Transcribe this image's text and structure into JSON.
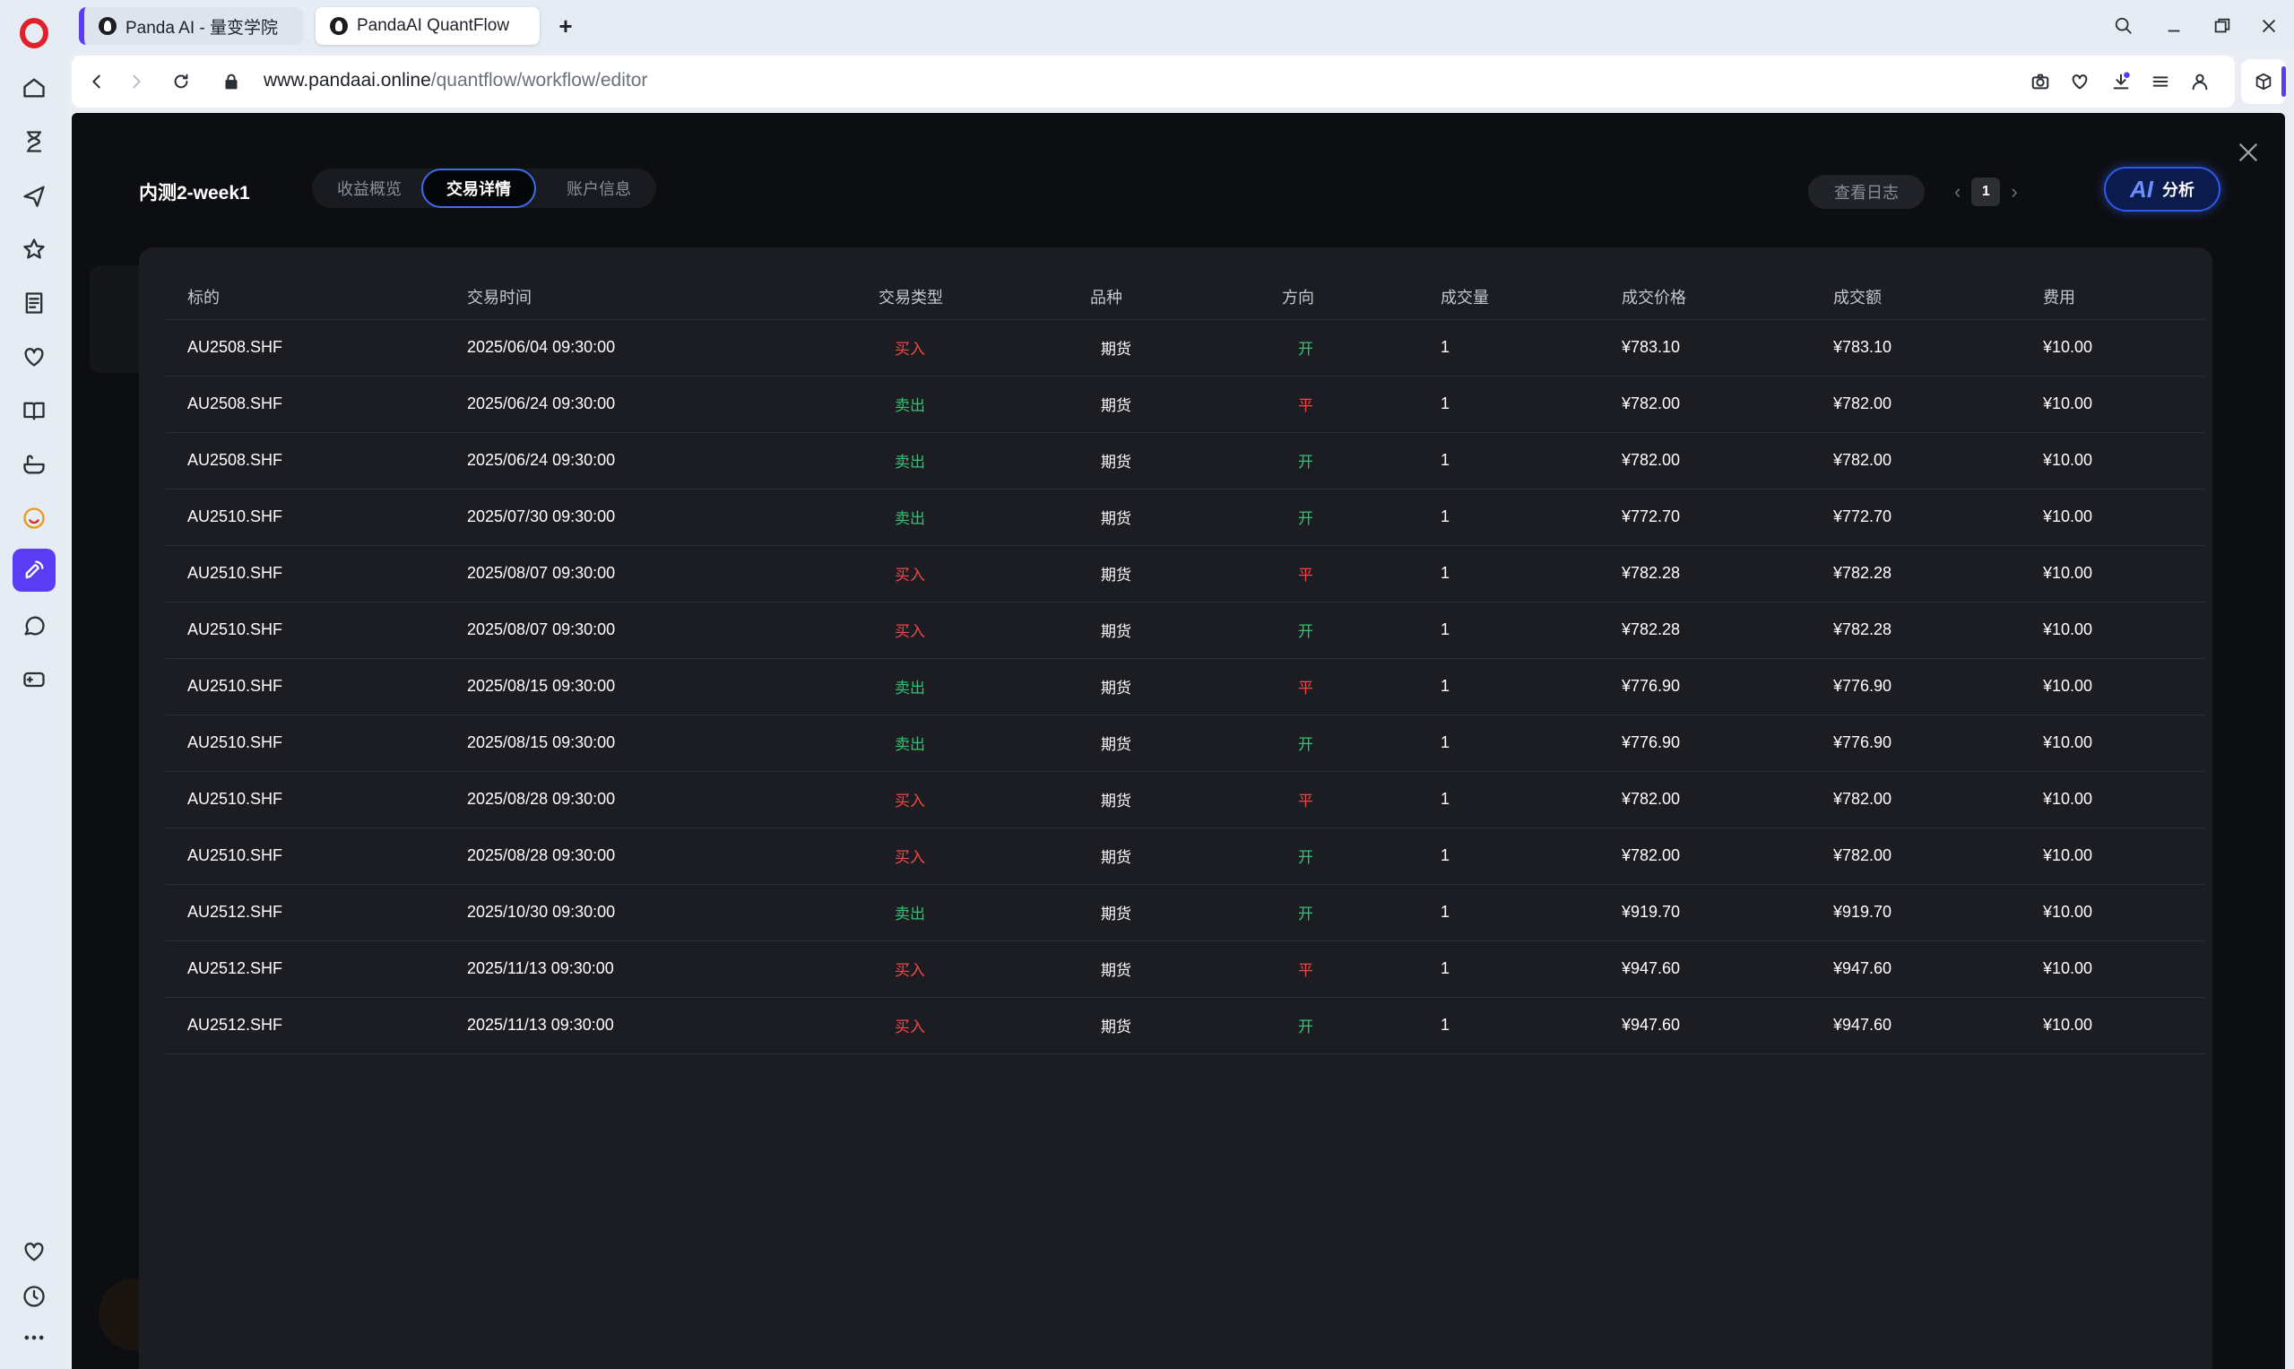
{
  "browser": {
    "tabs": [
      {
        "title": "Panda AI - 量变学院"
      },
      {
        "title": "PandaAI QuantFlow"
      }
    ],
    "url_host": "www.pandaai.online",
    "url_path": "/quantflow/workflow/editor"
  },
  "header": {
    "title": "内测2-week1",
    "tabs": [
      {
        "label": "收益概览"
      },
      {
        "label": "交易详情"
      },
      {
        "label": "账户信息"
      }
    ],
    "log_button": "查看日志",
    "page_number": "1",
    "ai_label": "AI",
    "ai_button": "分析"
  },
  "table": {
    "columns": [
      "标的",
      "交易时间",
      "交易类型",
      "品种",
      "方向",
      "成交量",
      "成交价格",
      "成交额",
      "费用"
    ],
    "rows": [
      {
        "symbol": "AU2508.SHF",
        "time": "2025/06/04 09:30:00",
        "side": "买入",
        "kind": "期货",
        "dir": "开",
        "qty": "1",
        "price": "¥783.10",
        "amount": "¥783.10",
        "fee": "¥10.00"
      },
      {
        "symbol": "AU2508.SHF",
        "time": "2025/06/24 09:30:00",
        "side": "卖出",
        "kind": "期货",
        "dir": "平",
        "qty": "1",
        "price": "¥782.00",
        "amount": "¥782.00",
        "fee": "¥10.00"
      },
      {
        "symbol": "AU2508.SHF",
        "time": "2025/06/24 09:30:00",
        "side": "卖出",
        "kind": "期货",
        "dir": "开",
        "qty": "1",
        "price": "¥782.00",
        "amount": "¥782.00",
        "fee": "¥10.00"
      },
      {
        "symbol": "AU2510.SHF",
        "time": "2025/07/30 09:30:00",
        "side": "卖出",
        "kind": "期货",
        "dir": "开",
        "qty": "1",
        "price": "¥772.70",
        "amount": "¥772.70",
        "fee": "¥10.00"
      },
      {
        "symbol": "AU2510.SHF",
        "time": "2025/08/07 09:30:00",
        "side": "买入",
        "kind": "期货",
        "dir": "平",
        "qty": "1",
        "price": "¥782.28",
        "amount": "¥782.28",
        "fee": "¥10.00"
      },
      {
        "symbol": "AU2510.SHF",
        "time": "2025/08/07 09:30:00",
        "side": "买入",
        "kind": "期货",
        "dir": "开",
        "qty": "1",
        "price": "¥782.28",
        "amount": "¥782.28",
        "fee": "¥10.00"
      },
      {
        "symbol": "AU2510.SHF",
        "time": "2025/08/15 09:30:00",
        "side": "卖出",
        "kind": "期货",
        "dir": "平",
        "qty": "1",
        "price": "¥776.90",
        "amount": "¥776.90",
        "fee": "¥10.00"
      },
      {
        "symbol": "AU2510.SHF",
        "time": "2025/08/15 09:30:00",
        "side": "卖出",
        "kind": "期货",
        "dir": "开",
        "qty": "1",
        "price": "¥776.90",
        "amount": "¥776.90",
        "fee": "¥10.00"
      },
      {
        "symbol": "AU2510.SHF",
        "time": "2025/08/28 09:30:00",
        "side": "买入",
        "kind": "期货",
        "dir": "平",
        "qty": "1",
        "price": "¥782.00",
        "amount": "¥782.00",
        "fee": "¥10.00"
      },
      {
        "symbol": "AU2510.SHF",
        "time": "2025/08/28 09:30:00",
        "side": "买入",
        "kind": "期货",
        "dir": "开",
        "qty": "1",
        "price": "¥782.00",
        "amount": "¥782.00",
        "fee": "¥10.00"
      },
      {
        "symbol": "AU2512.SHF",
        "time": "2025/10/30 09:30:00",
        "side": "卖出",
        "kind": "期货",
        "dir": "开",
        "qty": "1",
        "price": "¥919.70",
        "amount": "¥919.70",
        "fee": "¥10.00"
      },
      {
        "symbol": "AU2512.SHF",
        "time": "2025/11/13 09:30:00",
        "side": "买入",
        "kind": "期货",
        "dir": "平",
        "qty": "1",
        "price": "¥947.60",
        "amount": "¥947.60",
        "fee": "¥10.00"
      },
      {
        "symbol": "AU2512.SHF",
        "time": "2025/11/13 09:30:00",
        "side": "买入",
        "kind": "期货",
        "dir": "开",
        "qty": "1",
        "price": "¥947.60",
        "amount": "¥947.60",
        "fee": "¥10.00"
      }
    ]
  },
  "colors": {
    "accent": "#5b3cf5",
    "buy": "#f04848",
    "sell": "#2fc571",
    "page_bg": "#0d0e11",
    "panel_bg": "#1c1d22",
    "active_border": "#3c6cf2"
  },
  "icons": {
    "sidebar": [
      "opera-logo",
      "home-icon",
      "hourglass-icon",
      "plane-icon",
      "star-icon",
      "notes-icon",
      "heart-chat-icon",
      "book-icon",
      "tub-icon",
      "emoji-icon",
      "rocket-icon",
      "chat-icon",
      "gamepad-icon",
      "heart-icon",
      "clock-icon",
      "more-icon"
    ],
    "addressbar": [
      "back-icon",
      "forward-icon",
      "reload-icon",
      "lock-icon",
      "camera-icon",
      "heart-icon",
      "download-icon",
      "menu-icon",
      "profile-icon",
      "cube-icon"
    ],
    "window": [
      "search-icon",
      "minimize-icon",
      "restore-icon",
      "close-icon"
    ]
  }
}
